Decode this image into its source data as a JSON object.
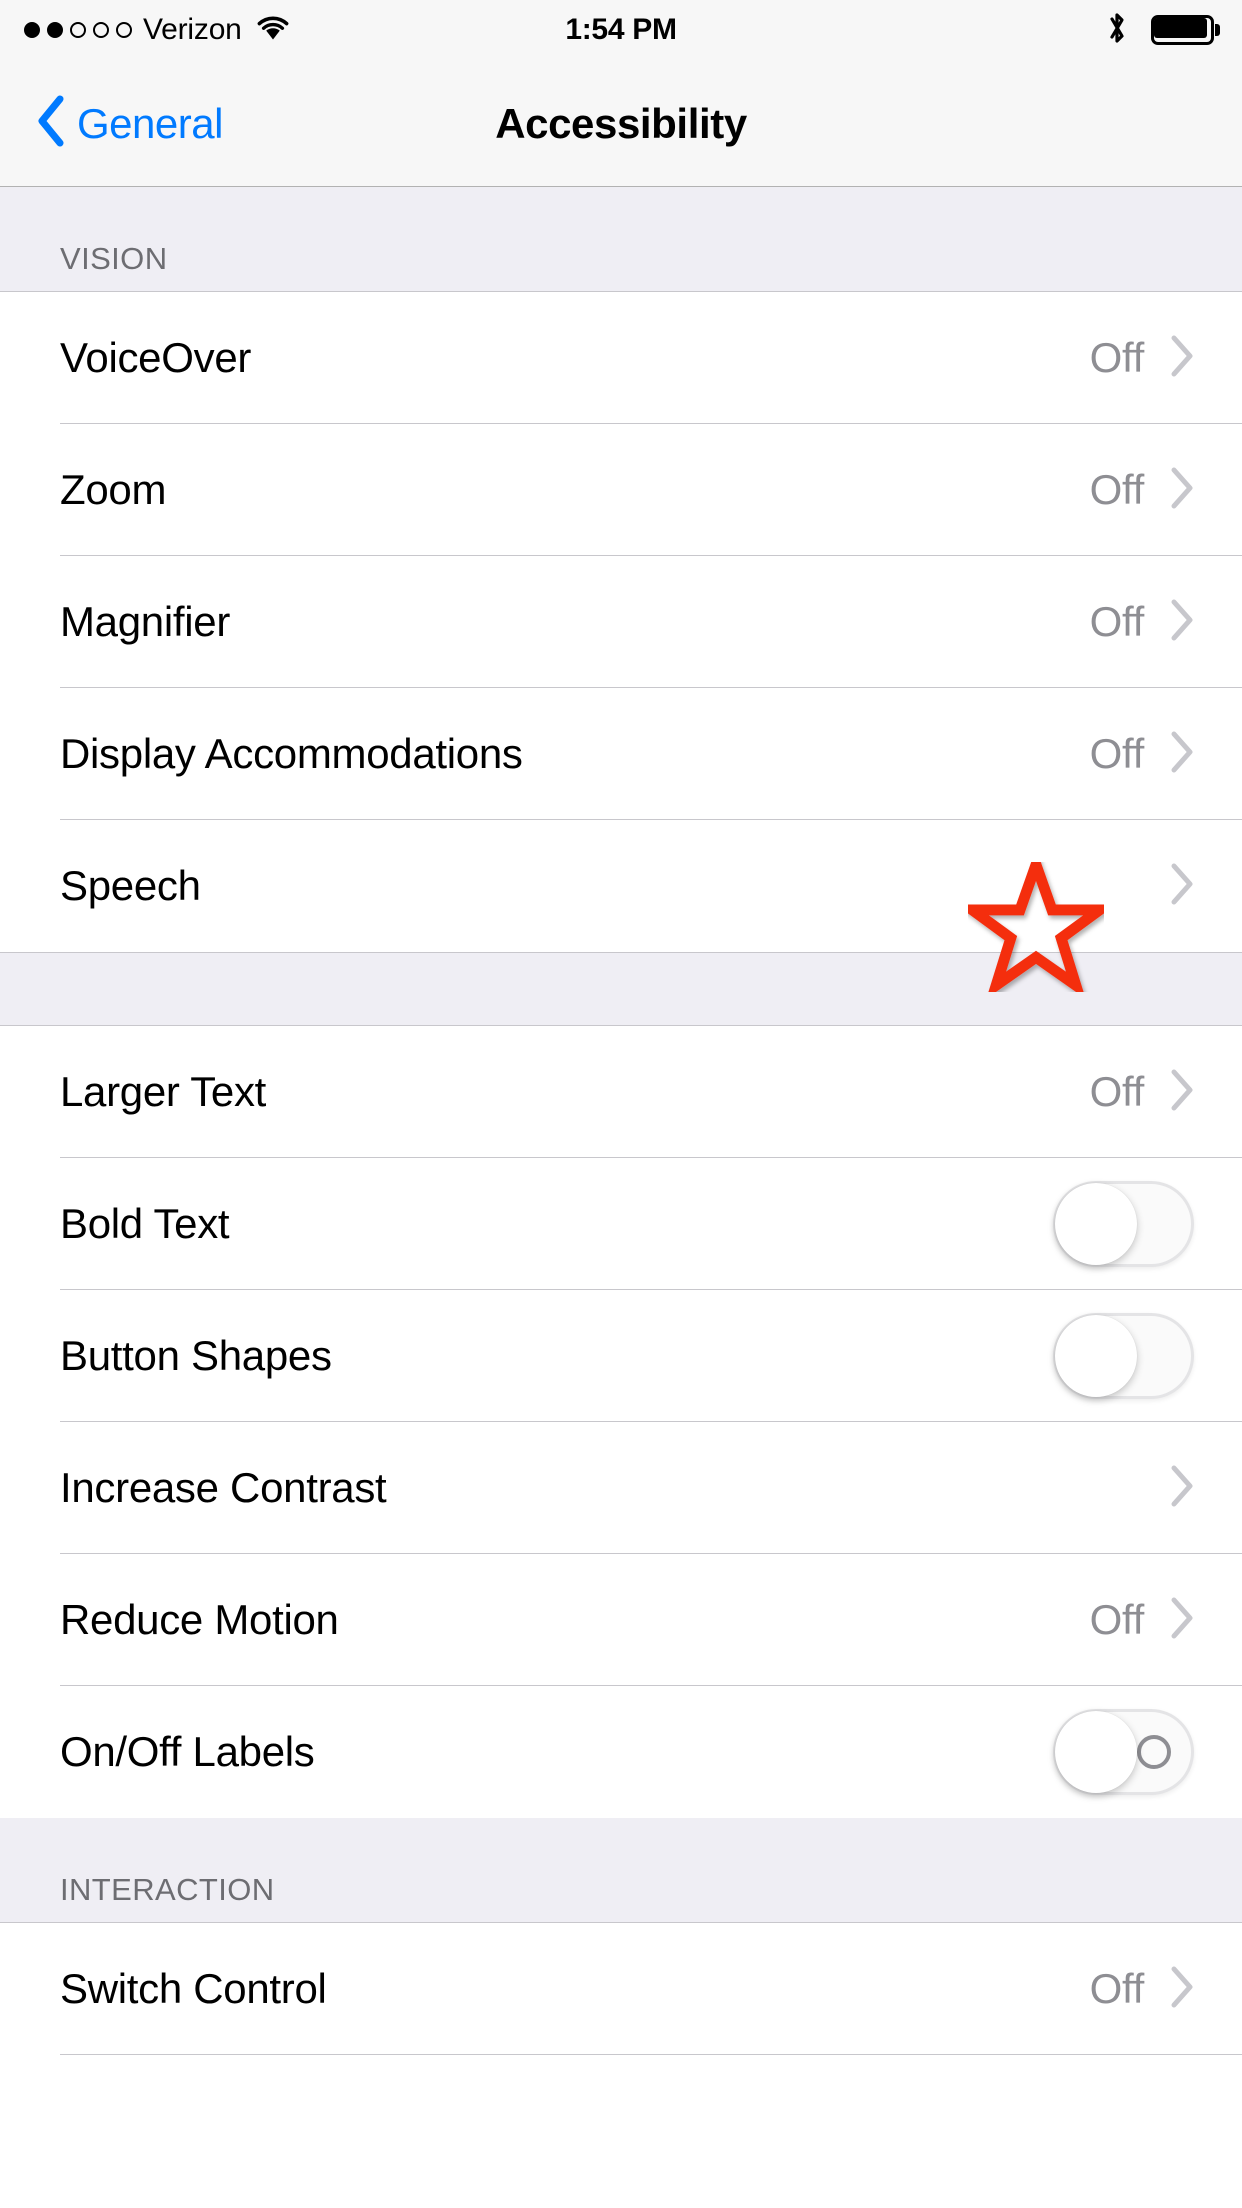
{
  "status_bar": {
    "carrier": "Verizon",
    "signal_filled": 2,
    "signal_total": 5,
    "wifi_icon": "wifi-icon",
    "time": "1:54 PM",
    "bluetooth_icon": "bluetooth-icon",
    "battery_icon": "battery-full-icon",
    "battery_level_percent": 100
  },
  "nav_bar": {
    "back_icon": "chevron-left-icon",
    "back_label": "General",
    "title": "Accessibility"
  },
  "sections": [
    {
      "header": "VISION",
      "rows": [
        {
          "label": "VoiceOver",
          "value": "Off",
          "accessory": "chevron",
          "starred": false
        },
        {
          "label": "Zoom",
          "value": "Off",
          "accessory": "chevron",
          "starred": false
        },
        {
          "label": "Magnifier",
          "value": "Off",
          "accessory": "chevron",
          "starred": false
        },
        {
          "label": "Display Accommodations",
          "value": "Off",
          "accessory": "chevron",
          "starred": false
        },
        {
          "label": "Speech",
          "value": "",
          "accessory": "chevron",
          "starred": true
        }
      ]
    },
    {
      "header": "",
      "rows": [
        {
          "label": "Larger Text",
          "value": "Off",
          "accessory": "chevron",
          "starred": false
        },
        {
          "label": "Bold Text",
          "value": "",
          "accessory": "toggle",
          "toggle_on": false,
          "toggle_label_mark": false,
          "starred": false
        },
        {
          "label": "Button Shapes",
          "value": "",
          "accessory": "toggle",
          "toggle_on": false,
          "toggle_label_mark": false,
          "starred": false
        },
        {
          "label": "Increase Contrast",
          "value": "",
          "accessory": "chevron",
          "starred": false
        },
        {
          "label": "Reduce Motion",
          "value": "Off",
          "accessory": "chevron",
          "starred": false
        },
        {
          "label": "On/Off Labels",
          "value": "",
          "accessory": "toggle",
          "toggle_on": false,
          "toggle_label_mark": true,
          "starred": false
        }
      ]
    },
    {
      "header": "INTERACTION",
      "rows": [
        {
          "label": "Switch Control",
          "value": "Off",
          "accessory": "chevron",
          "starred": false
        }
      ]
    }
  ],
  "annotation": {
    "icon": "star-icon",
    "color": "#F42D10",
    "target_row": "Speech"
  },
  "colors": {
    "accent_blue": "#007AFF",
    "section_bg": "#EFEEF4",
    "bar_bg": "#F7F7F7",
    "separator": "#C8C7CC",
    "value_gray": "#8E8E93",
    "header_gray": "#6D6D72"
  }
}
